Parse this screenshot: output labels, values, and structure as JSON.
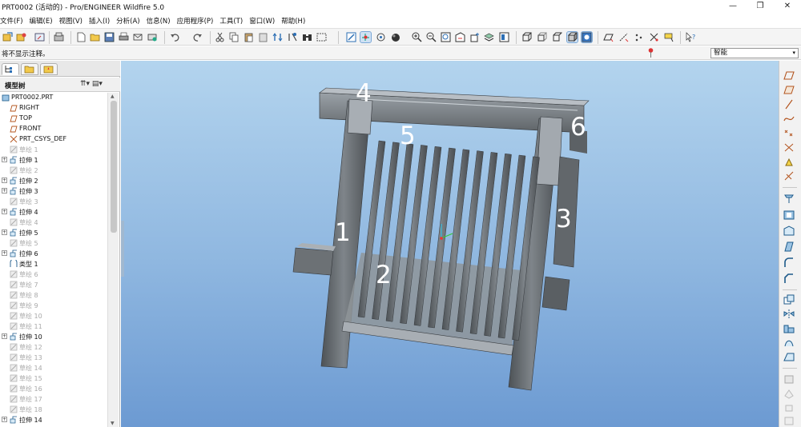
{
  "window": {
    "title": "PRT0002 (活动的) - Pro/ENGINEER Wildfire 5.0",
    "minimize": "—",
    "restore": "❐",
    "close": "✕"
  },
  "menu": [
    "文件(F)",
    "编辑(E)",
    "视图(V)",
    "插入(I)",
    "分析(A)",
    "信息(N)",
    "应用程序(P)",
    "工具(T)",
    "窗口(W)",
    "帮助(H)"
  ],
  "status": {
    "message": "将不显示注释。",
    "filter_value": "智能",
    "filter_arrow": "▾"
  },
  "model_tree": {
    "header": "模型树",
    "header_icons": "⇈▾  ▤▾",
    "items": [
      {
        "label": "PRT0002.PRT",
        "dim": false,
        "exp": false,
        "icon": "part-icon"
      },
      {
        "label": "RIGHT",
        "dim": false,
        "exp": false,
        "icon": "datum-plane-icon"
      },
      {
        "label": "TOP",
        "dim": false,
        "exp": false,
        "icon": "datum-plane-icon"
      },
      {
        "label": "FRONT",
        "dim": false,
        "exp": false,
        "icon": "datum-plane-icon"
      },
      {
        "label": "PRT_CSYS_DEF",
        "dim": false,
        "exp": false,
        "icon": "csys-icon"
      },
      {
        "label": "草绘 1",
        "dim": true,
        "exp": false,
        "icon": "sketch-icon"
      },
      {
        "label": "拉伸 1",
        "dim": false,
        "exp": true,
        "icon": "extrude-icon"
      },
      {
        "label": "草绘 2",
        "dim": true,
        "exp": false,
        "icon": "sketch-icon"
      },
      {
        "label": "拉伸 2",
        "dim": false,
        "exp": true,
        "icon": "extrude-icon"
      },
      {
        "label": "拉伸 3",
        "dim": false,
        "exp": true,
        "icon": "extrude-icon"
      },
      {
        "label": "草绘 3",
        "dim": true,
        "exp": false,
        "icon": "sketch-icon"
      },
      {
        "label": "拉伸 4",
        "dim": false,
        "exp": true,
        "icon": "extrude-icon"
      },
      {
        "label": "草绘 4",
        "dim": true,
        "exp": false,
        "icon": "sketch-icon"
      },
      {
        "label": "拉伸 5",
        "dim": false,
        "exp": true,
        "icon": "extrude-icon"
      },
      {
        "label": "草绘 5",
        "dim": true,
        "exp": false,
        "icon": "sketch-icon"
      },
      {
        "label": "拉伸 6",
        "dim": false,
        "exp": true,
        "icon": "extrude-icon"
      },
      {
        "label": "类型 1",
        "dim": false,
        "exp": false,
        "icon": "type-icon"
      },
      {
        "label": "草绘 6",
        "dim": true,
        "exp": false,
        "icon": "sketch-icon"
      },
      {
        "label": "草绘 7",
        "dim": true,
        "exp": false,
        "icon": "sketch-icon"
      },
      {
        "label": "草绘 8",
        "dim": true,
        "exp": false,
        "icon": "sketch-icon"
      },
      {
        "label": "草绘 9",
        "dim": true,
        "exp": false,
        "icon": "sketch-icon"
      },
      {
        "label": "草绘 10",
        "dim": true,
        "exp": false,
        "icon": "sketch-icon"
      },
      {
        "label": "草绘 11",
        "dim": true,
        "exp": false,
        "icon": "sketch-icon"
      },
      {
        "label": "拉伸 10",
        "dim": false,
        "exp": true,
        "icon": "extrude-icon"
      },
      {
        "label": "草绘 12",
        "dim": true,
        "exp": false,
        "icon": "sketch-icon"
      },
      {
        "label": "草绘 13",
        "dim": true,
        "exp": false,
        "icon": "sketch-icon"
      },
      {
        "label": "草绘 14",
        "dim": true,
        "exp": false,
        "icon": "sketch-icon"
      },
      {
        "label": "草绘 15",
        "dim": true,
        "exp": false,
        "icon": "sketch-icon"
      },
      {
        "label": "草绘 16",
        "dim": true,
        "exp": false,
        "icon": "sketch-icon"
      },
      {
        "label": "草绘 17",
        "dim": true,
        "exp": false,
        "icon": "sketch-icon"
      },
      {
        "label": "草绘 18",
        "dim": true,
        "exp": false,
        "icon": "sketch-icon"
      },
      {
        "label": "拉伸 14",
        "dim": false,
        "exp": true,
        "icon": "extrude-icon"
      }
    ]
  },
  "viewport": {
    "callouts": [
      "1",
      "2",
      "3",
      "4",
      "5",
      "6"
    ],
    "colors": {
      "model": "#6e7276",
      "model_dark": "#4f5357",
      "model_light": "#9aa0a6",
      "highlight": "#c8ced4"
    }
  },
  "colors": {
    "accent": "#7aa7d6",
    "dim_text": "#a8a8a8"
  }
}
